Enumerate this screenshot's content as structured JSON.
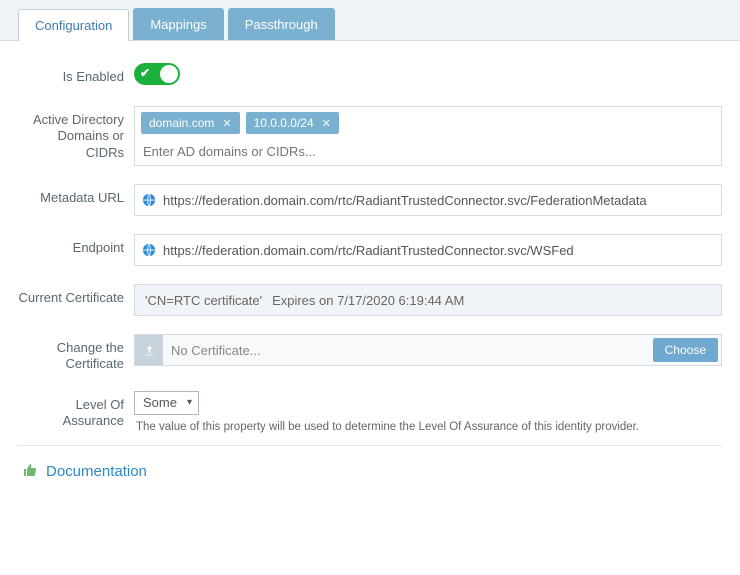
{
  "tabs": {
    "configuration": "Configuration",
    "mappings": "Mappings",
    "passthrough": "Passthrough"
  },
  "labels": {
    "isEnabled": "Is Enabled",
    "domains": "Active Directory Domains or CIDRs",
    "metadata": "Metadata URL",
    "endpoint": "Endpoint",
    "currentCert": "Current Certificate",
    "changeCert": "Change the Certificate",
    "loa": "Level Of Assurance"
  },
  "enabled": true,
  "domains": {
    "tags": [
      "domain.com",
      "10.0.0.0/24"
    ],
    "placeholder": "Enter AD domains or CIDRs..."
  },
  "metadataUrl": "https://federation.domain.com/rtc/RadiantTrustedConnector.svc/FederationMetadata",
  "endpointUrl": "https://federation.domain.com/rtc/RadiantTrustedConnector.svc/WSFed",
  "currentCertificate": {
    "subject": "'CN=RTC certificate'",
    "expires": "Expires on 7/17/2020 6:19:44 AM"
  },
  "changeCertificate": {
    "placeholder": "No Certificate...",
    "chooseLabel": "Choose"
  },
  "loa": {
    "selected": "Some",
    "help": "The value of this property will be used to determine the Level Of Assurance of this identity provider."
  },
  "documentationLabel": "Documentation"
}
